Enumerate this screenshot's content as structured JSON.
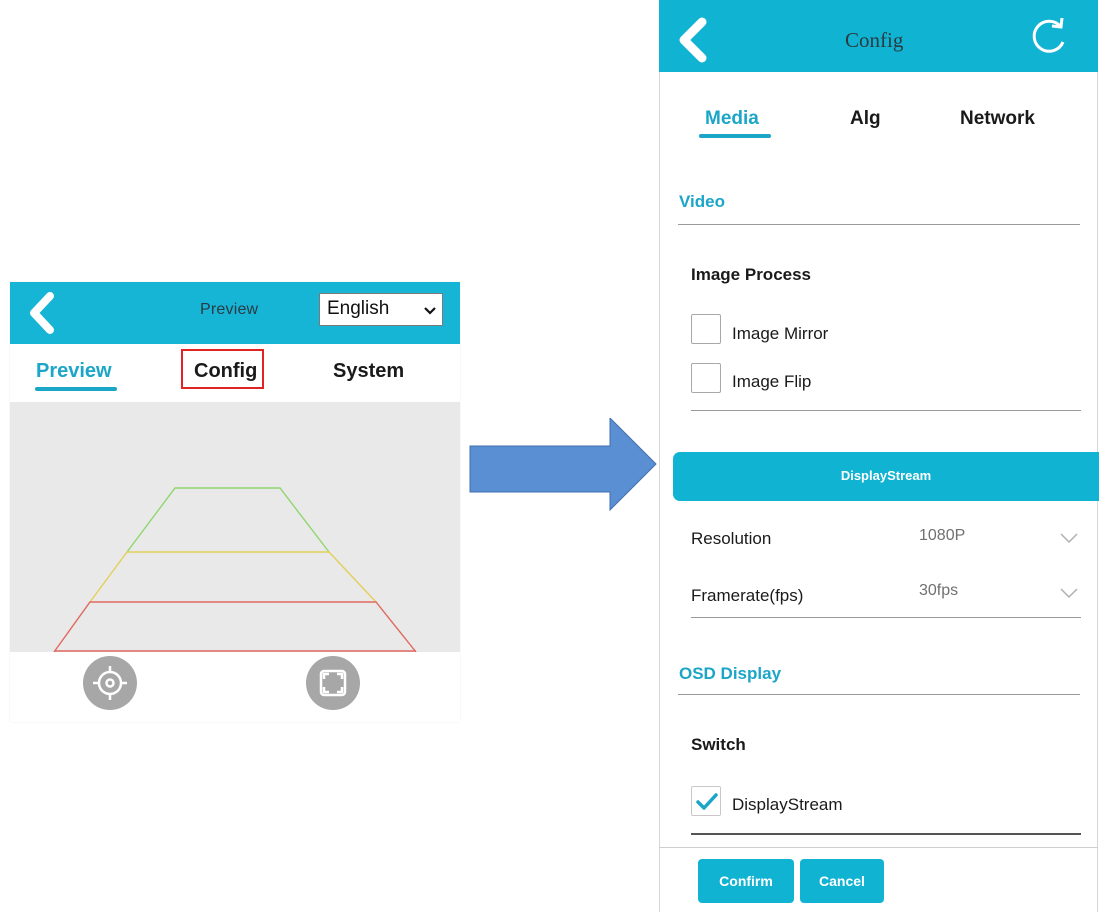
{
  "preview_screen": {
    "header": {
      "title": "Preview",
      "language_selected": "English"
    },
    "tabs": [
      {
        "label": "Preview",
        "active": true
      },
      {
        "label": "Config",
        "highlighted": true
      },
      {
        "label": "System"
      }
    ],
    "guide_line_colors": {
      "far": "#8fd66c",
      "middle": "#e2cf5b",
      "near": "#e06a60"
    },
    "icons": {
      "left_control": "target-icon",
      "right_control": "fullscreen-icon"
    }
  },
  "config_screen": {
    "header": {
      "title": "Config"
    },
    "tabs": [
      {
        "label": "Media",
        "active": true
      },
      {
        "label": "Alg"
      },
      {
        "label": "Network"
      }
    ],
    "video_section": {
      "title": "Video",
      "image_process": {
        "title": "Image Process",
        "options": [
          {
            "label": "Image Mirror",
            "checked": false
          },
          {
            "label": "Image Flip",
            "checked": false
          }
        ]
      }
    },
    "display_stream": {
      "bar_label": "DisplayStream",
      "settings": [
        {
          "label": "Resolution",
          "value": "1080P"
        },
        {
          "label": "Framerate(fps)",
          "value": "30fps"
        }
      ]
    },
    "osd_section": {
      "title": "OSD Display",
      "switch": {
        "title": "Switch",
        "options": [
          {
            "label": "DisplayStream",
            "checked": true
          }
        ]
      }
    },
    "footer": {
      "confirm_label": "Confirm",
      "cancel_label": "Cancel"
    }
  },
  "colors": {
    "accent": "#11b3d3",
    "tab_active": "#1ba6c8",
    "highlight_box": "#e02424",
    "arrow": "#5b8fd3"
  }
}
